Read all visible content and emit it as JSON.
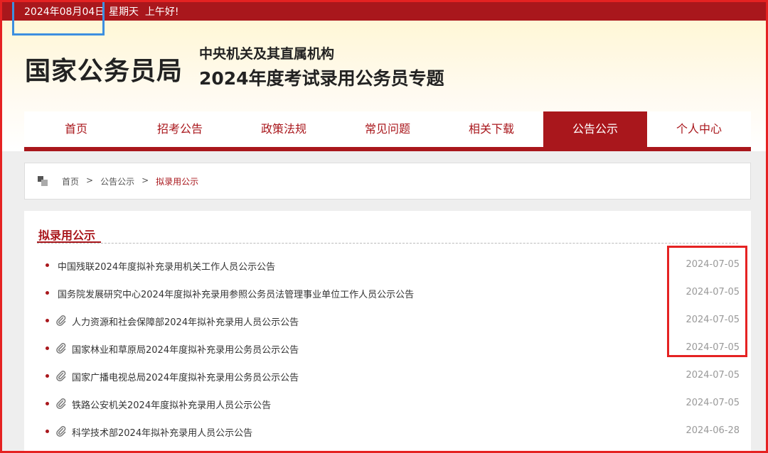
{
  "topbar": {
    "date": "2024年08月04日",
    "weekday": "星期天",
    "greeting": "上午好!"
  },
  "header": {
    "logo": "国家公务员局",
    "subtitle1": "中央机关及其直属机构",
    "subtitle2": "2024年度考试录用公务员专题"
  },
  "nav": [
    "首页",
    "招考公告",
    "政策法规",
    "常见问题",
    "相关下载",
    "公告公示",
    "个人中心"
  ],
  "nav_active": "公告公示",
  "breadcrumb": {
    "home": "首页",
    "sep1": ">",
    "section": "公告公示",
    "sep2": ">",
    "current": "拟录用公示"
  },
  "list": {
    "title": "拟录用公示",
    "items": [
      {
        "text": "中国残联2024年度拟补充录用机关工作人员公示公告",
        "date": "2024-07-05",
        "attachment": false
      },
      {
        "text": "国务院发展研究中心2024年度拟补充录用参照公务员法管理事业单位工作人员公示公告",
        "date": "2024-07-05",
        "attachment": false
      },
      {
        "text": "人力资源和社会保障部2024年拟补充录用人员公示公告",
        "date": "2024-07-05",
        "attachment": true
      },
      {
        "text": "国家林业和草原局2024年度拟补充录用公务员公示公告",
        "date": "2024-07-05",
        "attachment": true
      },
      {
        "text": "国家广播电视总局2024年度拟补充录用公务员公示公告",
        "date": "2024-07-05",
        "attachment": true
      },
      {
        "text": "铁路公安机关2024年度拟补充录用人员公示公告",
        "date": "2024-07-05",
        "attachment": true
      },
      {
        "text": "科学技术部2024年拟补充录用人员公示公告",
        "date": "2024-06-28",
        "attachment": true
      }
    ]
  },
  "colors": {
    "brand": "#a9171c",
    "highlight_red": "#e52222",
    "highlight_blue": "#3d8fe0"
  },
  "icons": {
    "attachment": "paperclip-icon",
    "breadcrumb": "location-squares-icon"
  }
}
